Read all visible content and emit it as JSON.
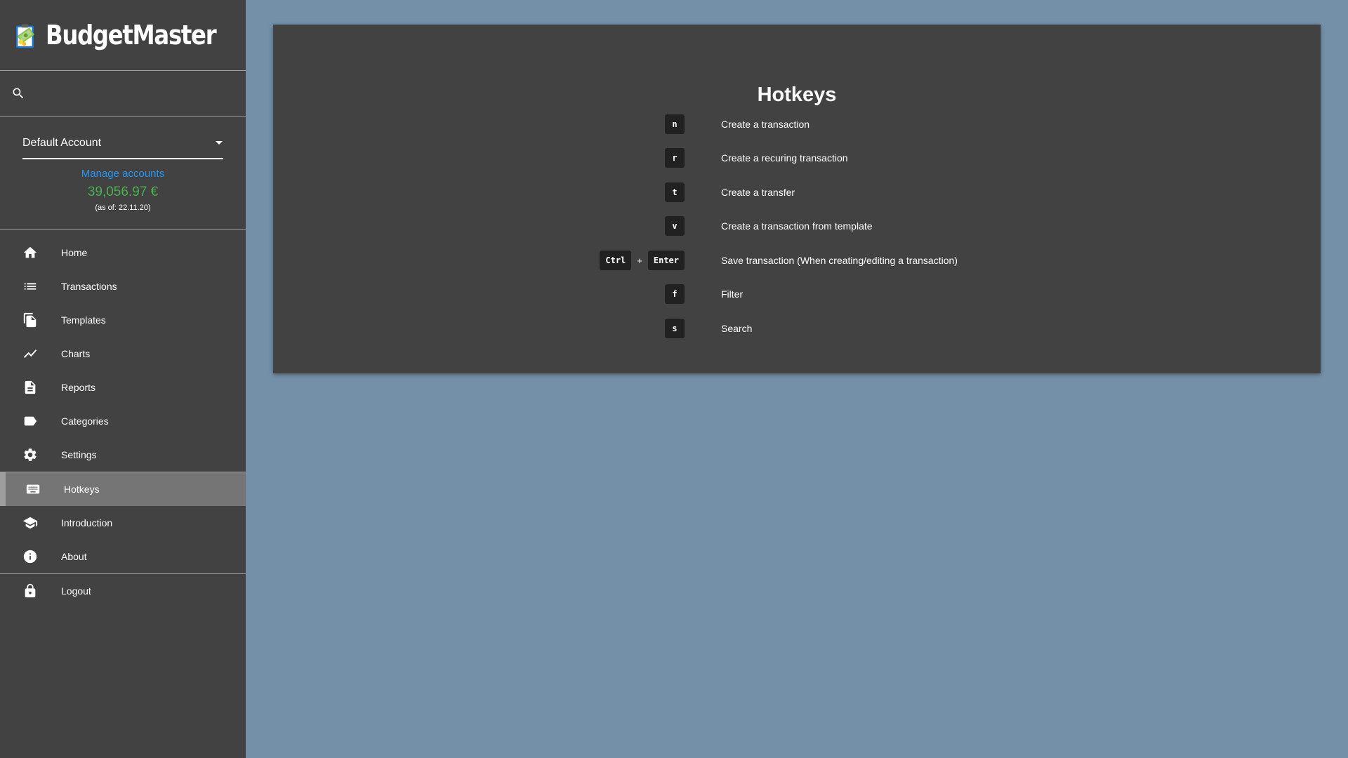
{
  "app": {
    "name": "BudgetMaster"
  },
  "search": {
    "placeholder": ""
  },
  "account": {
    "selected": "Default Account",
    "manage_label": "Manage accounts",
    "balance": "39,056.97 €",
    "as_of": "(as of: 22.11.20)"
  },
  "nav": {
    "items": [
      {
        "label": "Home",
        "icon": "home-icon"
      },
      {
        "label": "Transactions",
        "icon": "list-icon"
      },
      {
        "label": "Templates",
        "icon": "file-copy-icon"
      },
      {
        "label": "Charts",
        "icon": "line-chart-icon"
      },
      {
        "label": "Reports",
        "icon": "description-icon"
      },
      {
        "label": "Categories",
        "icon": "label-icon"
      },
      {
        "label": "Settings",
        "icon": "gear-icon"
      },
      {
        "label": "Hotkeys",
        "icon": "keyboard-icon",
        "active": true
      },
      {
        "label": "Introduction",
        "icon": "school-icon"
      },
      {
        "label": "About",
        "icon": "info-icon"
      },
      {
        "label": "Logout",
        "icon": "lock-icon"
      }
    ]
  },
  "colors": {
    "sidebar": "#424242",
    "background": "#7490a8",
    "accent_link": "#2196f3",
    "balance": "#4caf50",
    "active_item": "#757575"
  },
  "hotkeys": {
    "title": "Hotkeys",
    "rows": [
      {
        "keys": [
          "n"
        ],
        "plus": "",
        "description": "Create a transaction"
      },
      {
        "keys": [
          "r"
        ],
        "plus": "",
        "description": "Create a recuring transaction"
      },
      {
        "keys": [
          "t"
        ],
        "plus": "",
        "description": "Create a transfer"
      },
      {
        "keys": [
          "v"
        ],
        "plus": "",
        "description": "Create a transaction from template"
      },
      {
        "keys": [
          "Ctrl",
          "Enter"
        ],
        "plus": "+",
        "description": "Save transaction (When creating/editing a transaction)"
      },
      {
        "keys": [
          "f"
        ],
        "plus": "",
        "description": "Filter"
      },
      {
        "keys": [
          "s"
        ],
        "plus": "",
        "description": "Search"
      }
    ]
  }
}
